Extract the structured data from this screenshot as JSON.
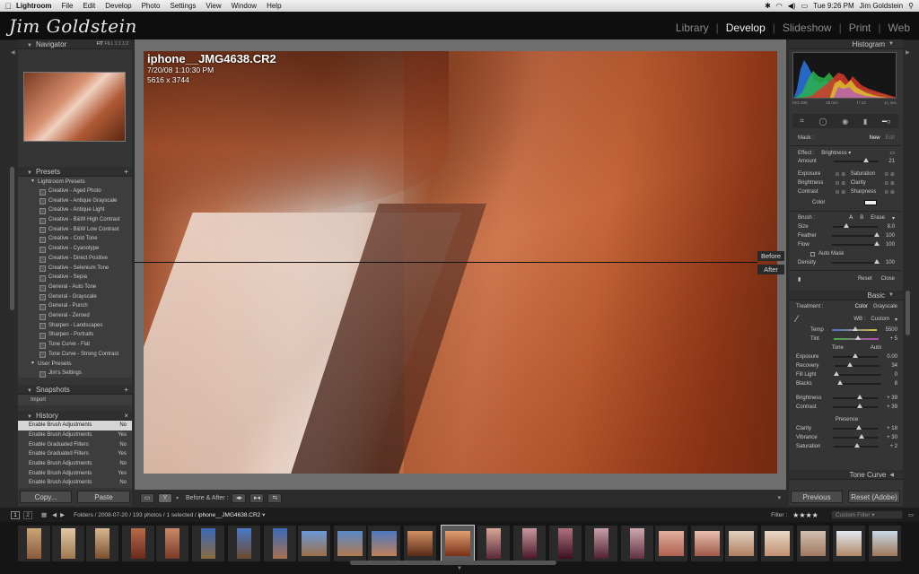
{
  "menubar": {
    "app": "Lightroom",
    "items": [
      "File",
      "Edit",
      "Develop",
      "Photo",
      "Settings",
      "View",
      "Window",
      "Help"
    ],
    "clock": "Tue 9:26 PM",
    "user": "Jim Goldstein"
  },
  "identity": "Jim Goldstein",
  "modules": [
    {
      "label": "Library",
      "active": false
    },
    {
      "label": "Develop",
      "active": true
    },
    {
      "label": "Slideshow",
      "active": false
    },
    {
      "label": "Print",
      "active": false
    },
    {
      "label": "Web",
      "active": false
    }
  ],
  "navigator": {
    "title": "Navigator",
    "zoom": [
      "FIT",
      "FILL",
      "1:1",
      "1:2"
    ]
  },
  "presets": {
    "title": "Presets",
    "folder1": "Lightroom Presets",
    "items": [
      "Creative - Aged Photo",
      "Creative - Antique Grayscale",
      "Creative - Antique Light",
      "Creative - B&W High Contrast",
      "Creative - B&W Low Contrast",
      "Creative - Cold Tone",
      "Creative - Cyanotype",
      "Creative - Direct Positive",
      "Creative - Selenium Tone",
      "Creative - Sepia",
      "General - Auto Tone",
      "General - Grayscale",
      "General - Punch",
      "General - Zeroed",
      "Sharpen - Landscapes",
      "Sharpen - Portraits",
      "Tone Curve - Flat",
      "Tone Curve - Strong Contrast"
    ],
    "folder2": "User Presets",
    "user_items": [
      "Jim's Settings"
    ]
  },
  "snapshots": {
    "title": "Snapshots",
    "import_label": "Import"
  },
  "history": {
    "title": "History",
    "items": [
      {
        "label": "Enable Brush Adjustments",
        "value": "No",
        "selected": true
      },
      {
        "label": "Enable Brush Adjustments",
        "value": "Yes",
        "selected": false
      },
      {
        "label": "Enable Graduated Filters",
        "value": "No",
        "selected": false
      },
      {
        "label": "Enable Graduated Filters",
        "value": "Yes",
        "selected": false
      },
      {
        "label": "Enable Brush Adjustments",
        "value": "No",
        "selected": false
      },
      {
        "label": "Enable Brush Adjustments",
        "value": "Yes",
        "selected": false
      },
      {
        "label": "Enable Brush Adjustments",
        "value": "No",
        "selected": false
      }
    ]
  },
  "left_buttons": {
    "copy": "Copy...",
    "paste": "Paste"
  },
  "photo": {
    "filename": "iphone__JMG4638.CR2",
    "datetime": "7/20/08 1:10:30 PM",
    "dimensions": "5616 x 3744"
  },
  "split_labels": {
    "before": "Before",
    "after": "After"
  },
  "toolbar": {
    "before_after": "Before & After :"
  },
  "histogram": {
    "title": "Histogram",
    "iso": "ISO 200",
    "focal": "18 mm",
    "aperture": "f / 13",
    "shutter": "1/₂ sec"
  },
  "mask": {
    "label": "Mask :",
    "new": "New",
    "edit": "Edit",
    "effect_label": "Effect :",
    "effect_value": "Brightness",
    "amount_label": "Amount",
    "amount_value": "21",
    "amount_frac": 0.72,
    "rows": [
      {
        "left": "Exposure",
        "right": "Saturation"
      },
      {
        "left": "Brightness",
        "right": "Clarity"
      },
      {
        "left": "Contrast",
        "right": "Sharpness"
      }
    ],
    "color_label": "Color",
    "brush_label": "Brush :",
    "brush_a": "A",
    "brush_b": "B",
    "brush_erase": "Erase",
    "brush_sliders": [
      {
        "label": "Size",
        "value": "8.0",
        "frac": 0.3
      },
      {
        "label": "Feather",
        "value": "100",
        "frac": 1.0
      },
      {
        "label": "Flow",
        "value": "100",
        "frac": 1.0
      }
    ],
    "automask": "Auto Mask",
    "density_label": "Density",
    "density_value": "100",
    "density_frac": 1.0,
    "reset": "Reset",
    "close": "Close"
  },
  "basic": {
    "title": "Basic",
    "treatment_label": "Treatment :",
    "color": "Color",
    "grayscale": "Grayscale",
    "wb_label": "WB :",
    "wb_value": "Custom",
    "temp_label": "Temp",
    "temp_value": "5500",
    "temp_frac": 0.52,
    "tint_label": "Tint",
    "tint_value": "+ 5",
    "tint_frac": 0.53,
    "tone_label": "Tone",
    "auto": "Auto",
    "tone_sliders": [
      {
        "label": "Exposure",
        "value": "0.00",
        "frac": 0.5
      },
      {
        "label": "Recovery",
        "value": "34",
        "frac": 0.34
      },
      {
        "label": "Fill Light",
        "value": "0",
        "frac": 0.0
      },
      {
        "label": "Blacks",
        "value": "8",
        "frac": 0.08
      }
    ],
    "bc_sliders": [
      {
        "label": "Brightness",
        "value": "+ 39",
        "frac": 0.6
      },
      {
        "label": "Contrast",
        "value": "+ 39",
        "frac": 0.6
      }
    ],
    "presence_label": "Presence",
    "presence_sliders": [
      {
        "label": "Clarity",
        "value": "+ 18",
        "frac": 0.59
      },
      {
        "label": "Vibrance",
        "value": "+ 30",
        "frac": 0.65
      },
      {
        "label": "Saturation",
        "value": "+ 2",
        "frac": 0.51
      }
    ]
  },
  "tone_curve": {
    "title": "Tone Curve"
  },
  "right_buttons": {
    "previous": "Previous",
    "reset": "Reset (Adobe)"
  },
  "filmstrip": {
    "page1": "1",
    "page2": "2",
    "path_prefix": "Folders / 2008-07-20 / 193 photos / 1 selected / ",
    "path_file": "iphone__JMG4638.CR2",
    "filter_label": "Filter :",
    "stars": "★★★★",
    "custom_filter": "Custom Filter"
  }
}
